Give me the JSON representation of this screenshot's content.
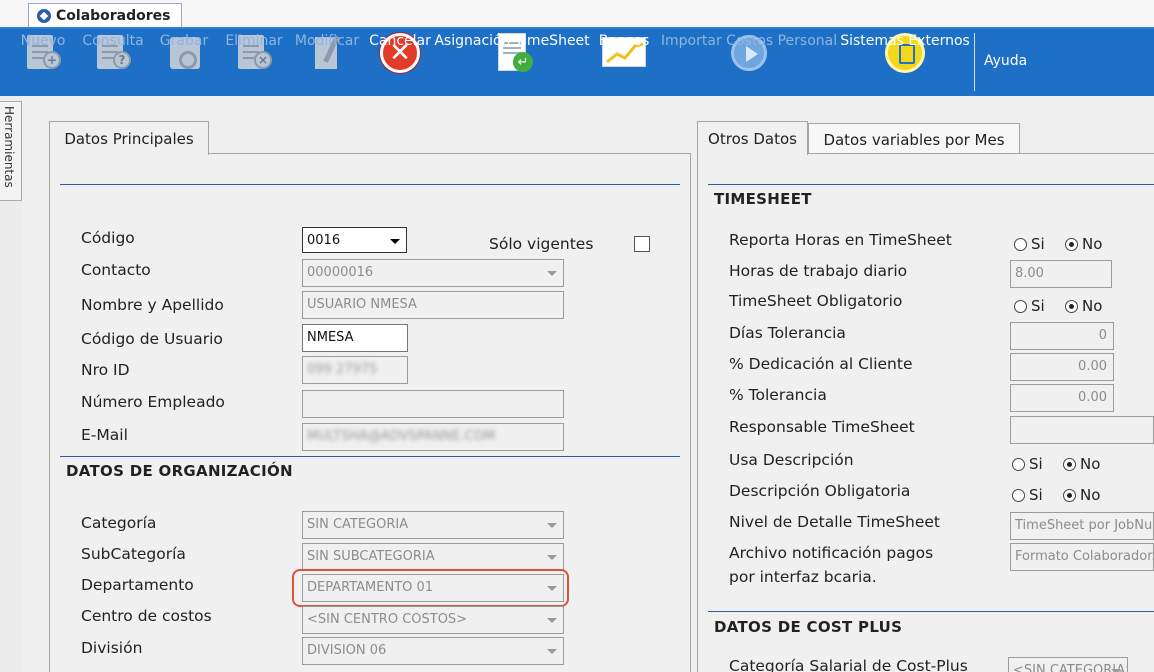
{
  "window_tab": {
    "title": "Colaboradores"
  },
  "toolbar": {
    "nuevo": "Nuevo",
    "consulta": "Consulta",
    "grabar": "Grabar",
    "eliminar": "Eliminar",
    "modificar": "Modificar",
    "cancelar": "Cancelar",
    "asignacion_timesheet": "Asignación TimeSheet",
    "bancos": "Bancos",
    "importar_costos": "Importar Costos Personal",
    "sistemas_externos": "Sistemas Externos",
    "ayuda": "Ayuda"
  },
  "side_tab": {
    "label": "Herramientas"
  },
  "left_panel": {
    "tab": "Datos Principales",
    "fields": {
      "codigo_label": "Código",
      "codigo_value": "0016",
      "solo_vigentes_label": "Sólo vigentes",
      "contacto_label": "Contacto",
      "contacto_value": "00000016",
      "nombre_label": "Nombre y Apellido",
      "nombre_value": "USUARIO NMESA",
      "codigo_usuario_label": "Código de Usuario",
      "codigo_usuario_value": "NMESA",
      "nro_id_label": "Nro ID",
      "nro_id_value": "099 27975",
      "numero_empleado_label": "Número Empleado",
      "numero_empleado_value": "",
      "email_label": "E-Mail",
      "email_value": "MULTSHA@ADVSPANNE.COM"
    },
    "org": {
      "section_title": "DATOS DE ORGANIZACIÓN",
      "categoria_label": "Categoría",
      "categoria_value": "SIN CATEGORIA",
      "subcategoria_label": "SubCategoría",
      "subcategoria_value": "SIN SUBCATEGORIA",
      "departamento_label": "Departamento",
      "departamento_value": "DEPARTAMENTO 01",
      "centro_costos_label": "Centro de costos",
      "centro_costos_value": "<SIN CENTRO COSTOS>",
      "division_label": "División",
      "division_value": "DIVISION 06"
    }
  },
  "right_panel": {
    "tab_otros": "Otros Datos",
    "tab_variables": "Datos variables por Mes",
    "timesheet": {
      "section_title": "TIMESHEET",
      "reporta_horas_label": "Reporta Horas en TimeSheet",
      "horas_diario_label": "Horas de trabajo diario",
      "horas_diario_value": "8.00",
      "obligatorio_label": "TimeSheet Obligatorio",
      "dias_tolerancia_label": "Días Tolerancia",
      "dias_tolerancia_value": "0",
      "dedicacion_label": "% Dedicación al Cliente",
      "dedicacion_value": "0.00",
      "tolerancia_label": "% Tolerancia",
      "tolerancia_value": "0.00",
      "responsable_label": "Responsable TimeSheet",
      "responsable_value": "",
      "usa_descripcion_label": "Usa Descripción",
      "descripcion_obligatoria_label": "Descripción Obligatoria",
      "nivel_detalle_label": "Nivel de Detalle TimeSheet",
      "nivel_detalle_value": "TimeSheet por JobNumber",
      "archivo_label_1": "Archivo notificación pagos",
      "archivo_label_2": "por interfaz bcaria.",
      "archivo_value": "Formato Colaborador.",
      "radio_si": "Si",
      "radio_no": "No"
    },
    "cost_plus": {
      "section_title": "DATOS DE COST PLUS",
      "categoria_salarial_label": "Categoría Salarial de Cost-Plus",
      "categoria_salarial_value": "<SIN CATEGORIA>"
    }
  }
}
